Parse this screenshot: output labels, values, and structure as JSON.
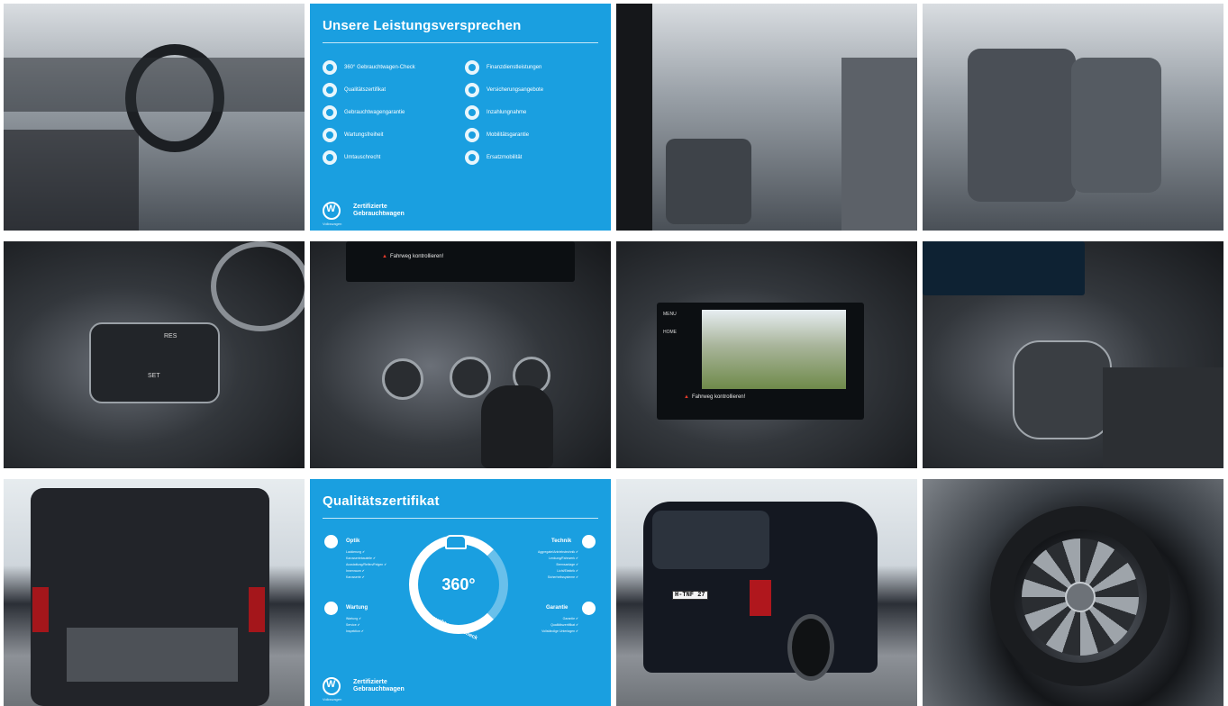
{
  "gallery": {
    "tiles": [
      {
        "kind": "photo",
        "subject": "dashboard-steering-wheel"
      },
      {
        "kind": "promo"
      },
      {
        "kind": "photo",
        "subject": "front-seats-side-door"
      },
      {
        "kind": "photo",
        "subject": "rear-captain-seats"
      },
      {
        "kind": "photo",
        "subject": "steering-wheel-buttons"
      },
      {
        "kind": "photo",
        "subject": "climate-controls"
      },
      {
        "kind": "photo",
        "subject": "infotainment-rear-camera"
      },
      {
        "kind": "photo",
        "subject": "gear-selector"
      },
      {
        "kind": "photo",
        "subject": "open-trunk"
      },
      {
        "kind": "certificate"
      },
      {
        "kind": "photo",
        "subject": "rear-exterior"
      },
      {
        "kind": "photo",
        "subject": "alloy-wheel"
      }
    ]
  },
  "promo": {
    "title": "Unsere Leistungsversprechen",
    "left_items": [
      "360° Gebrauchtwagen-Check",
      "Qualitätszertifikat",
      "Gebrauchtwagengarantie",
      "Wartungsfreiheit",
      "Umtauschrecht"
    ],
    "right_items": [
      "Finanzdienstleistungen",
      "Versicherungsangebote",
      "Inzahlungnahme",
      "Mobilitätsgarantie",
      "Ersatzmobilität"
    ],
    "brand_line1": "Zertifizierte",
    "brand_line2": "Gebrauchtwagen",
    "brand_small": "Volkswagen"
  },
  "certificate": {
    "title": "Qualitätszertifikat",
    "center_big": "360°",
    "center_arc": "Gebrauchtwagen-Check",
    "sections": {
      "optik": "Optik",
      "technik": "Technik",
      "wartung": "Wartung",
      "garantie": "Garantie"
    },
    "optik_bullets": [
      "Lackierung ✔",
      "Karosseriebauteile ✔",
      "Ausstattung/Reifen/Felgen ✔",
      "Innenraum ✔",
      "Karosserie ✔"
    ],
    "technik_bullets": [
      "Aggregate/Antriebstechnik ✔",
      "Lenkung/Fahrwerk ✔",
      "Bremsanlage ✔",
      "Licht/Elektrik ✔",
      "Sicherheitssysteme ✔"
    ],
    "wartung_bullets": [
      "Wartung ✔",
      "Service ✔",
      "Inspektion ✔"
    ],
    "garantie_bullets": [
      "Garantie ✔",
      "Qualitätszertifikat ✔",
      "Vollständige Unterlagen ✔"
    ],
    "brand_line1": "Zertifizierte",
    "brand_line2": "Gebrauchtwagen",
    "brand_small": "Volkswagen"
  },
  "photo_text": {
    "warn_top": "Fahrweg kontrollieren!",
    "warn_screen": "Fahrweg kontrollieren!",
    "screen_menu": "MENU",
    "screen_home": "HOME",
    "wheel_res": "RES",
    "wheel_set": "SET",
    "plate": "H-TNF 27"
  },
  "colors": {
    "promo_blue": "#1a9fe0",
    "white": "#ffffff"
  }
}
